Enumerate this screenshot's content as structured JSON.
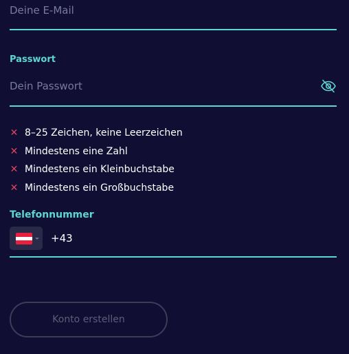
{
  "email": {
    "placeholder": "Deine E-Mail"
  },
  "password": {
    "label": "Passwort",
    "placeholder": "Dein Passwort",
    "toggle_icon": "eye-off-icon"
  },
  "requirements": [
    {
      "icon": "x-icon",
      "text": "8–25 Zeichen, keine Leerzeichen"
    },
    {
      "icon": "x-icon",
      "text": "Mindestens eine Zahl"
    },
    {
      "icon": "x-icon",
      "text": "Mindestens ein Kleinbuchstabe"
    },
    {
      "icon": "x-icon",
      "text": "Mindestens ein Großbuchstabe"
    }
  ],
  "phone": {
    "label": "Telefonnummer",
    "country_flag": "austria-flag-icon",
    "dial_code": "+43"
  },
  "submit": {
    "label": "Konto erstellen"
  },
  "colors": {
    "background": "#100f33",
    "accent": "#5ed6d0",
    "error": "#e0425d",
    "placeholder": "#7a7a9a",
    "disabled": "#5c5d78"
  }
}
